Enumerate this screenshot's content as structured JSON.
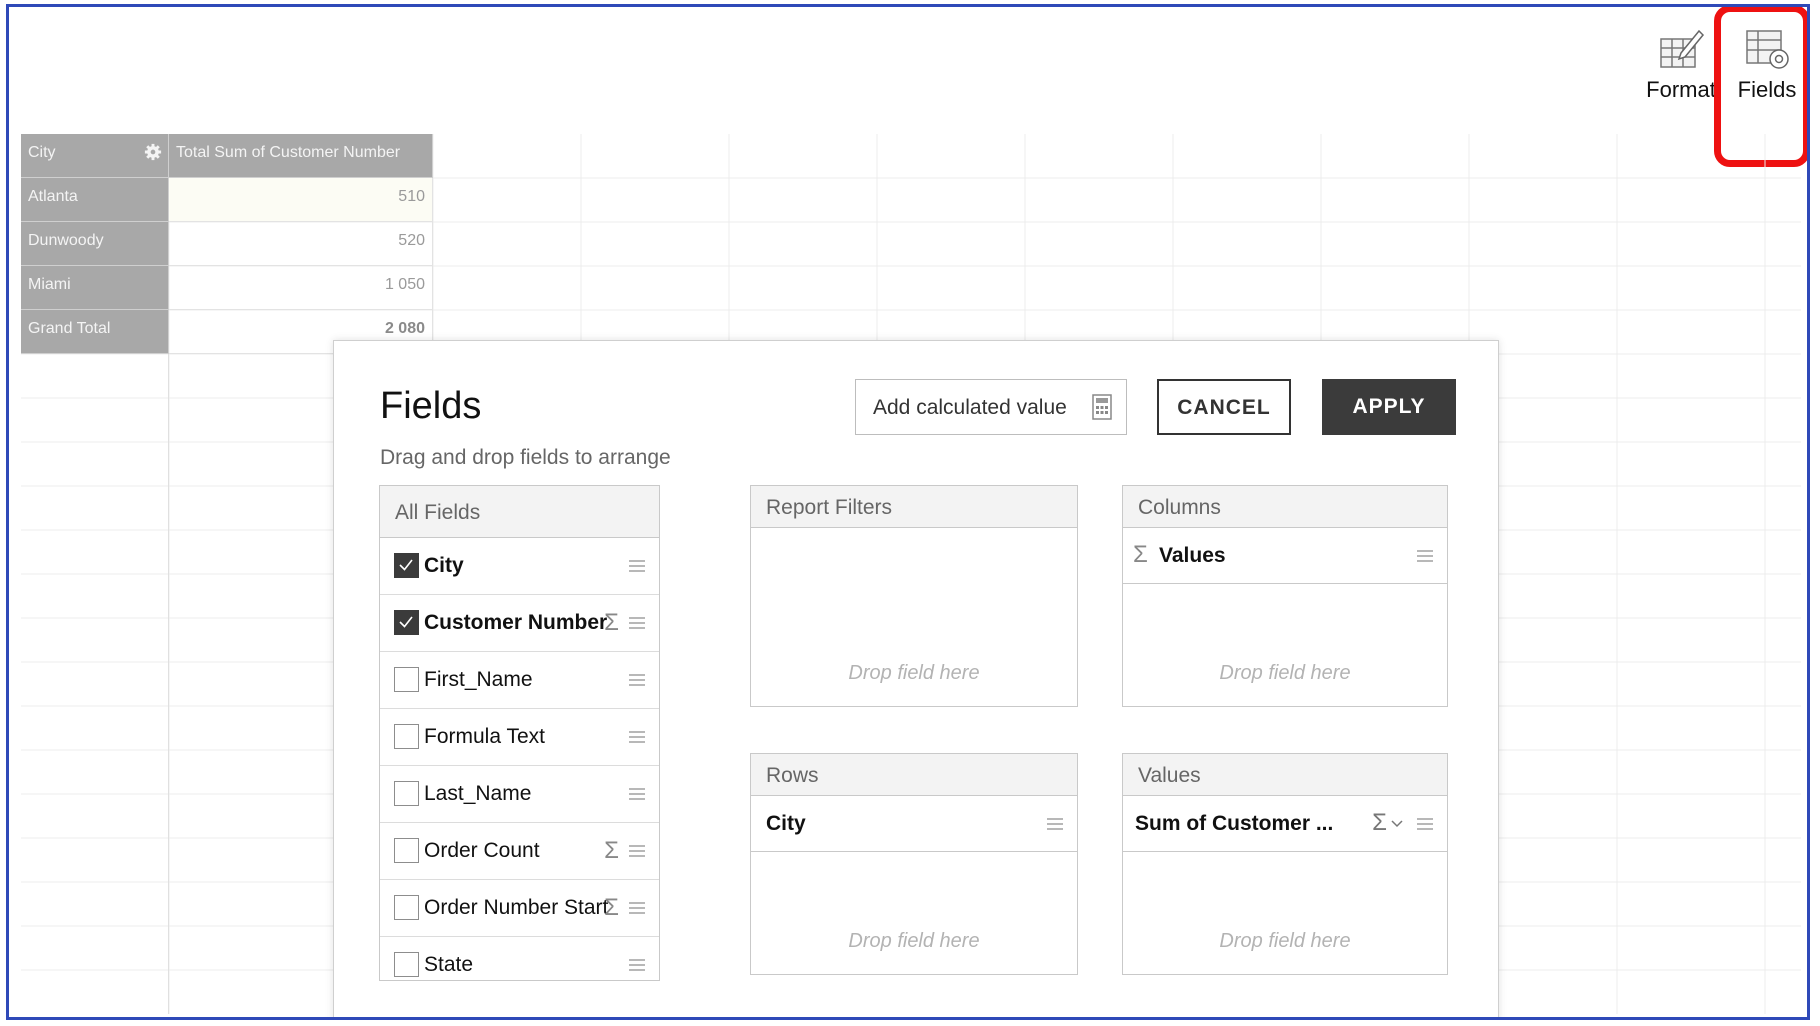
{
  "toolbar": {
    "format_label": "Format",
    "fields_label": "Fields",
    "highlight_color": "#ee1111"
  },
  "pivot": {
    "row_header": "City",
    "value_header": "Total Sum of Customer Number",
    "rows": [
      {
        "label": "Atlanta",
        "value": "510"
      },
      {
        "label": "Dunwoody",
        "value": "520"
      },
      {
        "label": "Miami",
        "value": "1 050"
      }
    ],
    "grand_total_label": "Grand Total",
    "grand_total_value": "2 080"
  },
  "dialog": {
    "title": "Fields",
    "subtitle": "Drag and drop fields to arrange",
    "add_calculated_label": "Add calculated value",
    "cancel_label": "CANCEL",
    "apply_label": "APPLY",
    "all_fields": {
      "heading": "All Fields",
      "items": [
        {
          "label": "City",
          "checked": true,
          "sigma": false
        },
        {
          "label": "Customer Number",
          "checked": true,
          "sigma": true
        },
        {
          "label": "First_Name",
          "checked": false,
          "sigma": false
        },
        {
          "label": "Formula Text",
          "checked": false,
          "sigma": false
        },
        {
          "label": "Last_Name",
          "checked": false,
          "sigma": false
        },
        {
          "label": "Order Count",
          "checked": false,
          "sigma": true
        },
        {
          "label": "Order Number Start",
          "checked": false,
          "sigma": true
        },
        {
          "label": "State",
          "checked": false,
          "sigma": false
        }
      ]
    },
    "report_filters": {
      "heading": "Report Filters",
      "drop_text": "Drop field here"
    },
    "columns": {
      "heading": "Columns",
      "field": "Values",
      "drop_text": "Drop field here"
    },
    "rows": {
      "heading": "Rows",
      "field": "City",
      "drop_text": "Drop field here"
    },
    "values": {
      "heading": "Values",
      "field": "Sum of Customer ...",
      "drop_text": "Drop field here"
    }
  }
}
